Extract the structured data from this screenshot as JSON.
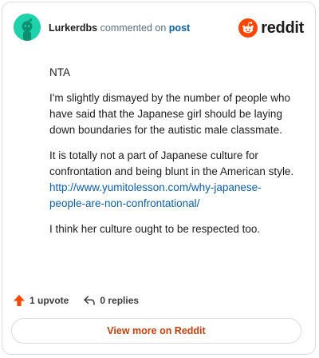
{
  "header": {
    "author": "Lurkerdbs",
    "action_text": "commented on",
    "post_link": "post",
    "brand": "reddit"
  },
  "comment": {
    "paragraphs": [
      "NTA",
      "I'm slightly dismayed by the number of people who have said that the Japanese girl should be laying down boundaries for the autistic male classmate.",
      "It is totally not a part of Japanese culture for confrontation and being blunt in the American style.",
      "I think her culture ought to be respected too."
    ],
    "link": "http://www.yumitolesson.com/why-japanese-people-are-non-confrontational/"
  },
  "stats": {
    "upvotes": "1 upvote",
    "replies": "0 replies"
  },
  "cta": {
    "label": "View more on Reddit"
  },
  "colors": {
    "avatar": "#1ed2ab",
    "brand_orange": "#ff4500",
    "link": "#0b5ea8",
    "cta_text": "#c2410c"
  }
}
